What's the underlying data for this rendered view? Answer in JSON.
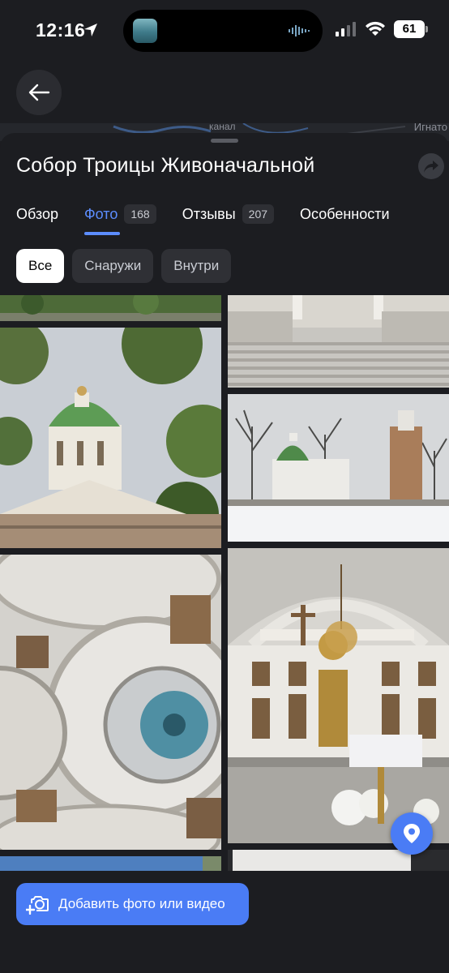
{
  "status_bar": {
    "time": "12:16",
    "battery": "61"
  },
  "map": {
    "label_right": "Игнато",
    "label_mid": "канал"
  },
  "place": {
    "title": "Собор Троицы Живоначальной"
  },
  "tabs": [
    {
      "label": "Обзор",
      "count": ""
    },
    {
      "label": "Фото",
      "count": "168"
    },
    {
      "label": "Отзывы",
      "count": "207"
    },
    {
      "label": "Особенности",
      "count": ""
    }
  ],
  "active_tab": "Фото",
  "filters": [
    {
      "label": "Все"
    },
    {
      "label": "Снаружи"
    },
    {
      "label": "Внутри"
    }
  ],
  "active_filter": "Все",
  "actions": {
    "add_media_label": "Добавить фото или видео"
  },
  "colors": {
    "accent": "#4a7cf5",
    "tab_active": "#5c8dff",
    "background": "#1c1d21"
  },
  "icons": [
    "location-arrow-icon",
    "signal-icon",
    "wifi-icon",
    "back-arrow-icon",
    "share-icon",
    "map-pin-icon",
    "add-photo-icon"
  ]
}
